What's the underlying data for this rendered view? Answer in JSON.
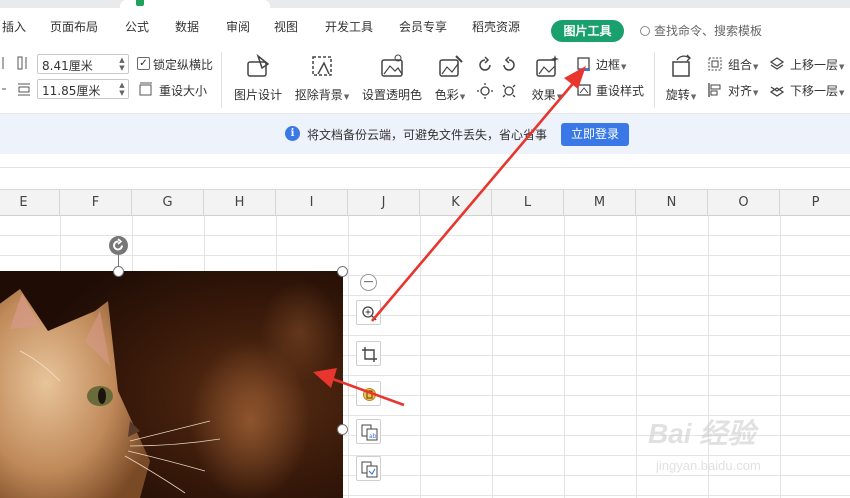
{
  "menu": {
    "items": [
      "插入",
      "页面布局",
      "公式",
      "数据",
      "审阅",
      "视图",
      "开发工具",
      "会员专享",
      "稻壳资源"
    ],
    "active_tab": "图片工具",
    "search": "查找命令、搜索模板"
  },
  "ribbon": {
    "width_value": "8.41厘米",
    "height_value": "11.85厘米",
    "lock_ratio_label": "锁定纵横比",
    "lock_ratio_checked": true,
    "reset_size_label": "重设大小",
    "picture_design": "图片设计",
    "remove_bg": "抠除背景",
    "set_transparent": "设置透明色",
    "color": "色彩",
    "effect": "效果",
    "border": "边框",
    "reset_style": "重设样式",
    "rotate": "旋转",
    "group": "组合",
    "align": "对齐",
    "bring_forward": "上移一层",
    "send_backward": "下移一层"
  },
  "notice": {
    "message": "将文档备份云端，可避免文件丢失，省心省事",
    "login_button": "立即登录"
  },
  "columns": [
    "E",
    "F",
    "G",
    "H",
    "I",
    "J",
    "K",
    "L",
    "M",
    "N",
    "O",
    "P"
  ],
  "watermark": {
    "main": "Bai 经验",
    "sub": "jingyan.baidu.com"
  },
  "colors": {
    "accent_green": "#1aa06d",
    "login_blue": "#3b78e7",
    "notice_bg": "#eef2fb",
    "annotation_red": "#e8352e"
  }
}
